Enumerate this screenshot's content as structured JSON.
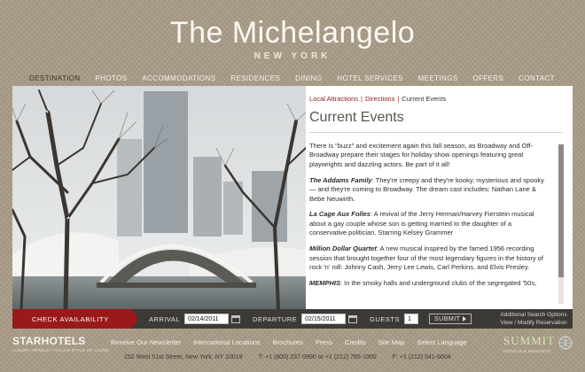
{
  "brand": {
    "title": "The Michelangelo",
    "subtitle": "NEW YORK"
  },
  "nav": [
    {
      "label": "DESTINATION",
      "active": true
    },
    {
      "label": "PHOTOS"
    },
    {
      "label": "ACCOMMODATIONS"
    },
    {
      "label": "RESIDENCES"
    },
    {
      "label": "DINING"
    },
    {
      "label": "HOTEL SERVICES"
    },
    {
      "label": "MEETINGS"
    },
    {
      "label": "OFFERS"
    },
    {
      "label": "CONTACT"
    }
  ],
  "breadcrumb": {
    "link1": "Local Attractions",
    "link2": "Directions",
    "current": "Current Events"
  },
  "page_title": "Current Events",
  "article": {
    "intro": "There is \"buzz\" and excitement again this fall season, as Broadway and Off-Broadway prepare their stages for holiday show openings featuring great playwrights and dazzling actors. Be part of it all!",
    "items": [
      {
        "title": "The Addams Family",
        "text": ": They're creepy and they're kooky, mysterious and spooky — and they're coming to Broadway. The dream cast includes: Nathan Lane & Bebe Neuwirth."
      },
      {
        "title": "La Cage Aux Folles",
        "text": ": A revival of the Jerry Herman/Harvey Fierstein musical about a gay couple whose son is getting married to the daughter of a conservative politician. Starring Kelsey Grammer"
      },
      {
        "title": "Million Dollar Quartet",
        "text": ": A new musical inspired by the famed 1956 recording session that brought together four of the most legendary figures in the history of rock 'n' roll: Johnny Cash, Jerry Lee Lewis, Carl Perkins, and Elvis Presley."
      },
      {
        "title": "MEMPHIS",
        "text": ": In the smoky halls and underground clubs of the segregated '50s,"
      }
    ]
  },
  "booking": {
    "check_label": "CHECK AVAILABILITY",
    "arrival_label": "ARRIVAL",
    "arrival_value": "02/14/2011",
    "departure_label": "DEPARTURE",
    "departure_value": "02/15/2011",
    "guests_label": "GUESTS",
    "guests_value": "1",
    "submit_label": "SUBMIT",
    "addl_search": "Additional Search Options",
    "view_modify": "View / Modify Reservation"
  },
  "footer": {
    "starhotels": "STARHOTELS",
    "starhotels_tag": "LUXURY HOTELS • ITALIAN STYLE OF LIVING",
    "links": [
      "Receive Our Newsletter",
      "International Locations",
      "Brochures",
      "Press",
      "Credits",
      "Site Map",
      "Select Language"
    ],
    "address": "152 West 51st Street, New York, NY 10019",
    "phone": "T: +1 (800) 237-0990 or +1 (212) 765-1900",
    "fax": "F: +1 (212) 541-6604",
    "summit": "SUMMIT",
    "summit_tag": "HOTELS & RESORTS"
  },
  "colors": {
    "accent_red": "#9a1a1a",
    "background": "#a89b87",
    "booking_bar": "#3c3a37"
  }
}
